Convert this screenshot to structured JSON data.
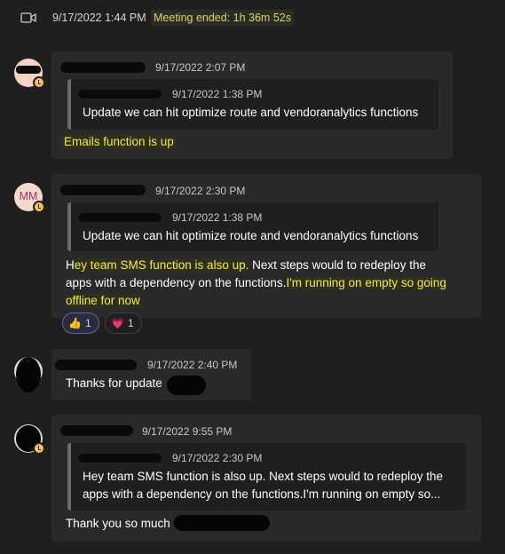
{
  "meeting": {
    "time": "9/17/2022 1:44 PM",
    "ended": "Meeting ended: 1h 36m 52s",
    "icon": "video-camera-icon"
  },
  "messages": [
    {
      "timestamp": "9/17/2022 2:07 PM",
      "quote": {
        "timestamp": "9/17/2022 1:38 PM",
        "text": "Update we can hit optimize route and vendoranalytics functions"
      },
      "text": "Emails function is up"
    },
    {
      "avatar_initials": "MM",
      "timestamp": "9/17/2022 2:30 PM",
      "quote": {
        "timestamp": "9/17/2022 1:38 PM",
        "text": "Update we can hit optimize route and vendoranalytics functions"
      },
      "text_parts": {
        "p1_first": "H",
        "p1_highlight": "ey team SMS function is also up.",
        "p1_rest": " Next steps would to redeploy the",
        "line2_plain": "apps with a dependency on the functions.",
        "line2_highlight": "I'm running on empty so going",
        "line3_highlight": "offline for now"
      },
      "reactions": [
        {
          "emoji": "👍",
          "count": "1",
          "icon": "thumbs-up-icon"
        },
        {
          "emoji": "💗",
          "count": "1",
          "icon": "heart-icon"
        }
      ]
    },
    {
      "timestamp": "9/17/2022 2:40 PM",
      "text": "Thanks for update"
    },
    {
      "timestamp": "9/17/2022 9:55 PM",
      "quote": {
        "timestamp": "9/17/2022 2:30 PM",
        "line1": "Hey team SMS function is also up. Next steps would to redeploy the",
        "line2": "apps with a dependency on the functions.I'm running on empty so..."
      },
      "text": "Thank you so much"
    }
  ],
  "colors": {
    "background": "#1f1f1f",
    "bubble": "#292929",
    "highlight_text": "#f0e93a",
    "presence_away": "#f8c34a"
  }
}
